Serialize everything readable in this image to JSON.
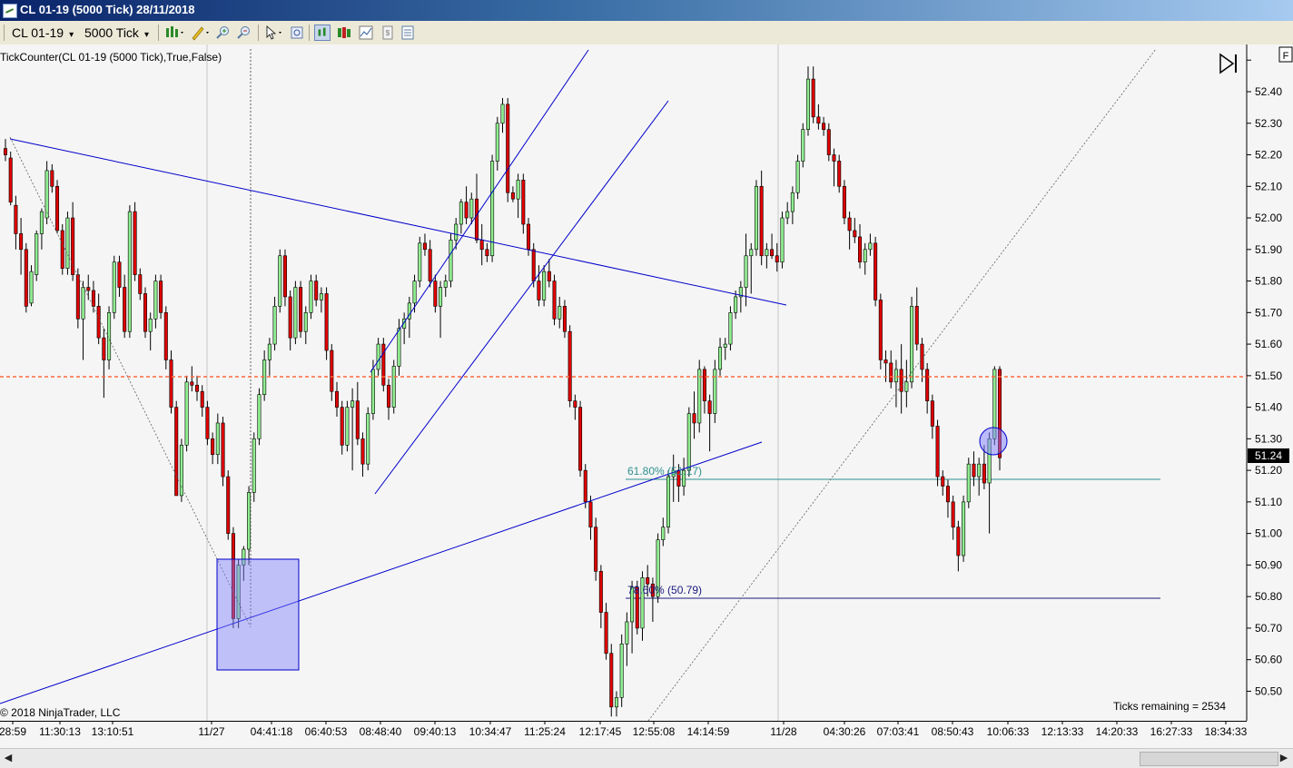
{
  "window": {
    "title": "CL 01-19 (5000 Tick)  28/11/2018"
  },
  "toolbar": {
    "instrument": "CL 01-19",
    "interval": "5000 Tick"
  },
  "chart_data": {
    "type": "candlestick",
    "indicator_label": "TickCounter(CL 01-19 (5000 Tick),True,False)",
    "copyright": "© 2018 NinjaTrader, LLC",
    "ticks_remaining": "Ticks remaining = 2534",
    "current_price": "51.24",
    "last_price_line": 51.49,
    "ylim": [
      50.42,
      52.52
    ],
    "y_ticks": [
      "52.40",
      "52.30",
      "52.20",
      "52.10",
      "52.00",
      "51.90",
      "51.80",
      "51.70",
      "51.60",
      "51.50",
      "51.40",
      "51.30",
      "51.20",
      "51.10",
      "51.00",
      "50.90",
      "50.80",
      "50.70",
      "50.60",
      "50.50"
    ],
    "x_ticks": [
      "28:59",
      "11:30:13",
      "13:10:51",
      "11/27",
      "04:41:18",
      "06:40:53",
      "08:48:40",
      "09:40:13",
      "10:34:47",
      "11:25:24",
      "12:17:45",
      "12:55:08",
      "14:14:59",
      "11/28",
      "04:30:26",
      "07:03:41",
      "08:50:43",
      "10:06:33",
      "12:13:33",
      "14:20:33",
      "16:27:33",
      "18:34:33"
    ],
    "fib_levels": [
      {
        "label": "61.80% (51.17)",
        "value": 51.17
      },
      {
        "label": "78.60% (50.79)",
        "value": 50.79
      }
    ],
    "colors": {
      "up": "#90ee90",
      "down": "#e00000",
      "trendline": "#0000cc",
      "price_line": "#ff6a3d",
      "fib_618": "#2f8f8f",
      "fib_786": "#1a1a80"
    },
    "candles": [
      [
        52.22,
        52.25,
        52.18,
        52.2
      ],
      [
        52.19,
        52.21,
        52.04,
        52.05
      ],
      [
        52.04,
        52.07,
        51.9,
        51.95
      ],
      [
        51.95,
        52.0,
        51.82,
        51.9
      ],
      [
        51.9,
        51.92,
        51.7,
        51.72
      ],
      [
        51.73,
        51.85,
        51.72,
        51.83
      ],
      [
        51.82,
        51.96,
        51.8,
        51.95
      ],
      [
        51.95,
        52.03,
        51.9,
        52.02
      ],
      [
        52.0,
        52.18,
        51.98,
        52.15
      ],
      [
        52.15,
        52.17,
        52.08,
        52.1
      ],
      [
        52.1,
        52.12,
        51.95,
        51.96
      ],
      [
        51.96,
        51.98,
        51.82,
        51.84
      ],
      [
        51.84,
        52.02,
        51.82,
        52.0
      ],
      [
        52.0,
        52.05,
        51.8,
        51.82
      ],
      [
        51.82,
        51.84,
        51.65,
        51.68
      ],
      [
        51.68,
        51.8,
        51.55,
        51.78
      ],
      [
        51.78,
        51.82,
        51.74,
        51.77
      ],
      [
        51.77,
        51.8,
        51.7,
        51.72
      ],
      [
        51.72,
        51.76,
        51.6,
        51.62
      ],
      [
        51.62,
        51.65,
        51.43,
        51.55
      ],
      [
        51.55,
        51.72,
        51.52,
        51.7
      ],
      [
        51.7,
        51.88,
        51.68,
        51.86
      ],
      [
        51.86,
        51.88,
        51.75,
        51.78
      ],
      [
        51.78,
        51.82,
        51.62,
        51.64
      ],
      [
        51.64,
        52.04,
        51.62,
        52.02
      ],
      [
        52.02,
        52.05,
        51.8,
        51.82
      ],
      [
        51.82,
        51.84,
        51.74,
        51.76
      ],
      [
        51.76,
        51.78,
        51.62,
        51.64
      ],
      [
        51.64,
        51.7,
        51.58,
        51.68
      ],
      [
        51.68,
        51.82,
        51.65,
        51.8
      ],
      [
        51.8,
        51.82,
        51.68,
        51.7
      ],
      [
        51.7,
        51.72,
        51.52,
        51.55
      ],
      [
        51.55,
        51.58,
        51.38,
        51.4
      ],
      [
        51.4,
        51.42,
        51.12,
        51.12
      ],
      [
        51.12,
        51.3,
        51.1,
        51.28
      ],
      [
        51.28,
        51.5,
        51.26,
        51.48
      ],
      [
        51.48,
        51.53,
        51.45,
        51.47
      ],
      [
        51.47,
        51.5,
        51.42,
        51.45
      ],
      [
        51.45,
        51.47,
        51.37,
        51.4
      ],
      [
        51.4,
        51.42,
        51.28,
        51.3
      ],
      [
        51.3,
        51.32,
        51.22,
        51.25
      ],
      [
        51.25,
        51.38,
        51.22,
        51.35
      ],
      [
        51.35,
        51.37,
        51.15,
        51.18
      ],
      [
        51.18,
        51.2,
        50.98,
        51.0
      ],
      [
        51.0,
        51.02,
        50.7,
        50.73
      ],
      [
        50.73,
        50.92,
        50.7,
        50.9
      ],
      [
        50.9,
        50.96,
        50.85,
        50.95
      ],
      [
        50.95,
        51.15,
        50.9,
        51.13
      ],
      [
        51.13,
        51.32,
        51.1,
        51.3
      ],
      [
        51.3,
        51.46,
        51.28,
        51.44
      ],
      [
        51.44,
        51.58,
        51.42,
        51.55
      ],
      [
        51.55,
        51.62,
        51.5,
        51.6
      ],
      [
        51.6,
        51.75,
        51.58,
        51.72
      ],
      [
        51.72,
        51.9,
        51.7,
        51.88
      ],
      [
        51.88,
        51.9,
        51.72,
        51.75
      ],
      [
        51.75,
        51.77,
        51.58,
        51.62
      ],
      [
        51.62,
        51.8,
        51.6,
        51.78
      ],
      [
        51.78,
        51.8,
        51.62,
        51.64
      ],
      [
        51.64,
        51.72,
        51.6,
        51.7
      ],
      [
        51.7,
        51.82,
        51.68,
        51.8
      ],
      [
        51.8,
        51.82,
        51.72,
        51.74
      ],
      [
        51.74,
        51.78,
        51.7,
        51.76
      ],
      [
        51.76,
        51.78,
        51.55,
        51.58
      ],
      [
        51.58,
        51.6,
        51.42,
        51.45
      ],
      [
        51.45,
        51.48,
        51.37,
        51.4
      ],
      [
        51.4,
        51.42,
        51.25,
        51.28
      ],
      [
        51.28,
        51.42,
        51.26,
        51.4
      ],
      [
        51.4,
        51.46,
        51.2,
        51.42
      ],
      [
        51.42,
        51.48,
        51.28,
        51.3
      ],
      [
        51.3,
        51.32,
        51.18,
        51.22
      ],
      [
        51.22,
        51.4,
        51.2,
        51.38
      ],
      [
        51.38,
        51.55,
        51.36,
        51.52
      ],
      [
        51.52,
        51.62,
        51.5,
        51.6
      ],
      [
        51.6,
        51.62,
        51.45,
        51.47
      ],
      [
        51.47,
        51.49,
        51.36,
        51.4
      ],
      [
        51.4,
        51.55,
        51.38,
        51.53
      ],
      [
        51.53,
        51.68,
        51.5,
        51.65
      ],
      [
        51.65,
        51.7,
        51.6,
        51.68
      ],
      [
        51.68,
        51.75,
        51.62,
        51.73
      ],
      [
        51.73,
        51.82,
        51.7,
        51.8
      ],
      [
        51.8,
        51.94,
        51.78,
        51.92
      ],
      [
        51.92,
        51.95,
        51.88,
        51.9
      ],
      [
        51.9,
        51.93,
        51.78,
        51.8
      ],
      [
        51.8,
        51.82,
        51.7,
        51.72
      ],
      [
        51.72,
        51.8,
        51.62,
        51.78
      ],
      [
        51.78,
        51.82,
        51.75,
        51.8
      ],
      [
        51.8,
        51.95,
        51.78,
        51.93
      ],
      [
        51.93,
        52.0,
        51.9,
        51.98
      ],
      [
        51.98,
        52.06,
        51.95,
        52.05
      ],
      [
        52.05,
        52.1,
        51.98,
        52.0
      ],
      [
        52.0,
        52.08,
        51.98,
        52.06
      ],
      [
        52.06,
        52.14,
        51.92,
        51.93
      ],
      [
        51.93,
        51.98,
        51.85,
        51.9
      ],
      [
        51.9,
        51.92,
        51.86,
        51.88
      ],
      [
        51.88,
        52.2,
        51.86,
        52.18
      ],
      [
        52.18,
        52.32,
        52.15,
        52.3
      ],
      [
        52.3,
        52.38,
        52.27,
        52.36
      ],
      [
        52.36,
        52.38,
        52.05,
        52.08
      ],
      [
        52.08,
        52.1,
        52.05,
        52.06
      ],
      [
        52.06,
        52.14,
        52.0,
        52.12
      ],
      [
        52.12,
        52.14,
        51.95,
        51.98
      ],
      [
        51.98,
        52.0,
        51.88,
        51.9
      ],
      [
        51.9,
        51.92,
        51.78,
        51.8
      ],
      [
        51.8,
        51.85,
        51.72,
        51.74
      ],
      [
        51.74,
        51.85,
        51.72,
        51.83
      ],
      [
        51.83,
        51.87,
        51.78,
        51.8
      ],
      [
        51.8,
        51.82,
        51.66,
        51.68
      ],
      [
        51.68,
        51.75,
        51.65,
        51.72
      ],
      [
        51.72,
        51.74,
        51.62,
        51.64
      ],
      [
        51.64,
        51.66,
        51.4,
        51.42
      ],
      [
        51.42,
        51.44,
        51.36,
        51.4
      ],
      [
        51.4,
        51.42,
        51.18,
        51.2
      ],
      [
        51.2,
        51.22,
        51.08,
        51.1
      ],
      [
        51.1,
        51.12,
        50.98,
        51.02
      ],
      [
        51.02,
        51.05,
        50.85,
        50.88
      ],
      [
        50.88,
        50.9,
        50.7,
        50.75
      ],
      [
        50.75,
        50.78,
        50.6,
        50.62
      ],
      [
        50.62,
        50.65,
        50.42,
        50.45
      ],
      [
        50.45,
        50.5,
        50.42,
        50.48
      ],
      [
        50.48,
        50.68,
        50.45,
        50.65
      ],
      [
        50.65,
        50.75,
        50.58,
        50.72
      ],
      [
        50.72,
        50.85,
        50.62,
        50.83
      ],
      [
        50.83,
        50.85,
        50.68,
        50.7
      ],
      [
        50.7,
        50.88,
        50.66,
        50.86
      ],
      [
        50.86,
        50.9,
        50.8,
        50.84
      ],
      [
        50.84,
        50.86,
        50.72,
        50.8
      ],
      [
        50.8,
        51.0,
        50.78,
        50.98
      ],
      [
        50.98,
        51.05,
        50.96,
        51.02
      ],
      [
        51.02,
        51.2,
        51.0,
        51.18
      ],
      [
        51.18,
        51.25,
        51.1,
        51.2
      ],
      [
        51.2,
        51.22,
        51.1,
        51.15
      ],
      [
        51.15,
        51.24,
        51.12,
        51.2
      ],
      [
        51.2,
        51.4,
        51.18,
        51.38
      ],
      [
        51.38,
        51.45,
        51.3,
        51.35
      ],
      [
        51.35,
        51.55,
        51.32,
        51.52
      ],
      [
        51.52,
        51.53,
        51.38,
        51.42
      ],
      [
        51.42,
        51.44,
        51.26,
        51.38
      ],
      [
        51.38,
        51.55,
        51.35,
        51.52
      ],
      [
        51.52,
        51.62,
        51.5,
        51.59
      ],
      [
        51.59,
        51.62,
        51.55,
        51.6
      ],
      [
        51.6,
        51.72,
        51.58,
        51.7
      ],
      [
        51.7,
        51.77,
        51.68,
        51.75
      ],
      [
        51.75,
        51.8,
        51.7,
        51.78
      ],
      [
        51.78,
        51.95,
        51.72,
        51.88
      ],
      [
        51.88,
        51.92,
        51.76,
        51.9
      ],
      [
        51.9,
        52.12,
        51.88,
        52.1
      ],
      [
        52.1,
        52.15,
        51.85,
        51.88
      ],
      [
        51.88,
        51.92,
        51.84,
        51.9
      ],
      [
        51.9,
        51.95,
        51.87,
        51.88
      ],
      [
        51.88,
        51.92,
        51.83,
        51.86
      ],
      [
        51.86,
        52.02,
        51.84,
        52.0
      ],
      [
        52.0,
        52.05,
        51.98,
        52.02
      ],
      [
        52.02,
        52.1,
        51.98,
        52.08
      ],
      [
        52.08,
        52.2,
        52.06,
        52.18
      ],
      [
        52.18,
        52.3,
        52.16,
        52.28
      ],
      [
        52.28,
        52.48,
        52.26,
        52.44
      ],
      [
        52.44,
        52.48,
        52.3,
        52.32
      ],
      [
        52.32,
        52.36,
        52.28,
        52.3
      ],
      [
        52.3,
        52.32,
        52.26,
        52.28
      ],
      [
        52.28,
        52.3,
        52.18,
        52.2
      ],
      [
        52.2,
        52.22,
        52.1,
        52.18
      ],
      [
        52.18,
        52.2,
        52.08,
        52.1
      ],
      [
        52.1,
        52.12,
        51.98,
        52.0
      ],
      [
        52.0,
        52.02,
        51.9,
        51.96
      ],
      [
        51.96,
        52.0,
        51.92,
        51.94
      ],
      [
        51.94,
        51.98,
        51.84,
        51.86
      ],
      [
        51.86,
        51.92,
        51.82,
        51.9
      ],
      [
        51.9,
        51.95,
        51.88,
        51.92
      ],
      [
        51.92,
        51.94,
        51.72,
        51.74
      ],
      [
        51.74,
        51.76,
        51.52,
        51.55
      ],
      [
        51.55,
        51.58,
        51.48,
        51.54
      ],
      [
        51.54,
        51.58,
        51.46,
        51.48
      ],
      [
        51.48,
        51.55,
        51.4,
        51.52
      ],
      [
        51.52,
        51.6,
        51.38,
        51.45
      ],
      [
        51.45,
        51.55,
        51.4,
        51.48
      ],
      [
        51.48,
        51.75,
        51.46,
        51.72
      ],
      [
        51.72,
        51.78,
        51.58,
        51.6
      ],
      [
        51.6,
        51.62,
        51.48,
        51.52
      ],
      [
        51.52,
        51.54,
        51.38,
        51.42
      ],
      [
        51.42,
        51.44,
        51.3,
        51.34
      ],
      [
        51.34,
        51.36,
        51.15,
        51.18
      ],
      [
        51.18,
        51.2,
        51.12,
        51.15
      ],
      [
        51.15,
        51.17,
        51.05,
        51.1
      ],
      [
        51.1,
        51.12,
        50.98,
        51.02
      ],
      [
        51.02,
        51.04,
        50.88,
        50.93
      ],
      [
        50.93,
        51.12,
        50.91,
        51.1
      ],
      [
        51.1,
        51.24,
        51.08,
        51.22
      ],
      [
        51.22,
        51.26,
        51.15,
        51.18
      ],
      [
        51.18,
        51.24,
        51.12,
        51.22
      ],
      [
        51.22,
        51.28,
        51.14,
        51.16
      ],
      [
        51.16,
        51.32,
        51.0,
        51.3
      ],
      [
        51.3,
        51.53,
        51.28,
        51.52
      ],
      [
        51.52,
        51.53,
        51.2,
        51.24
      ]
    ]
  }
}
